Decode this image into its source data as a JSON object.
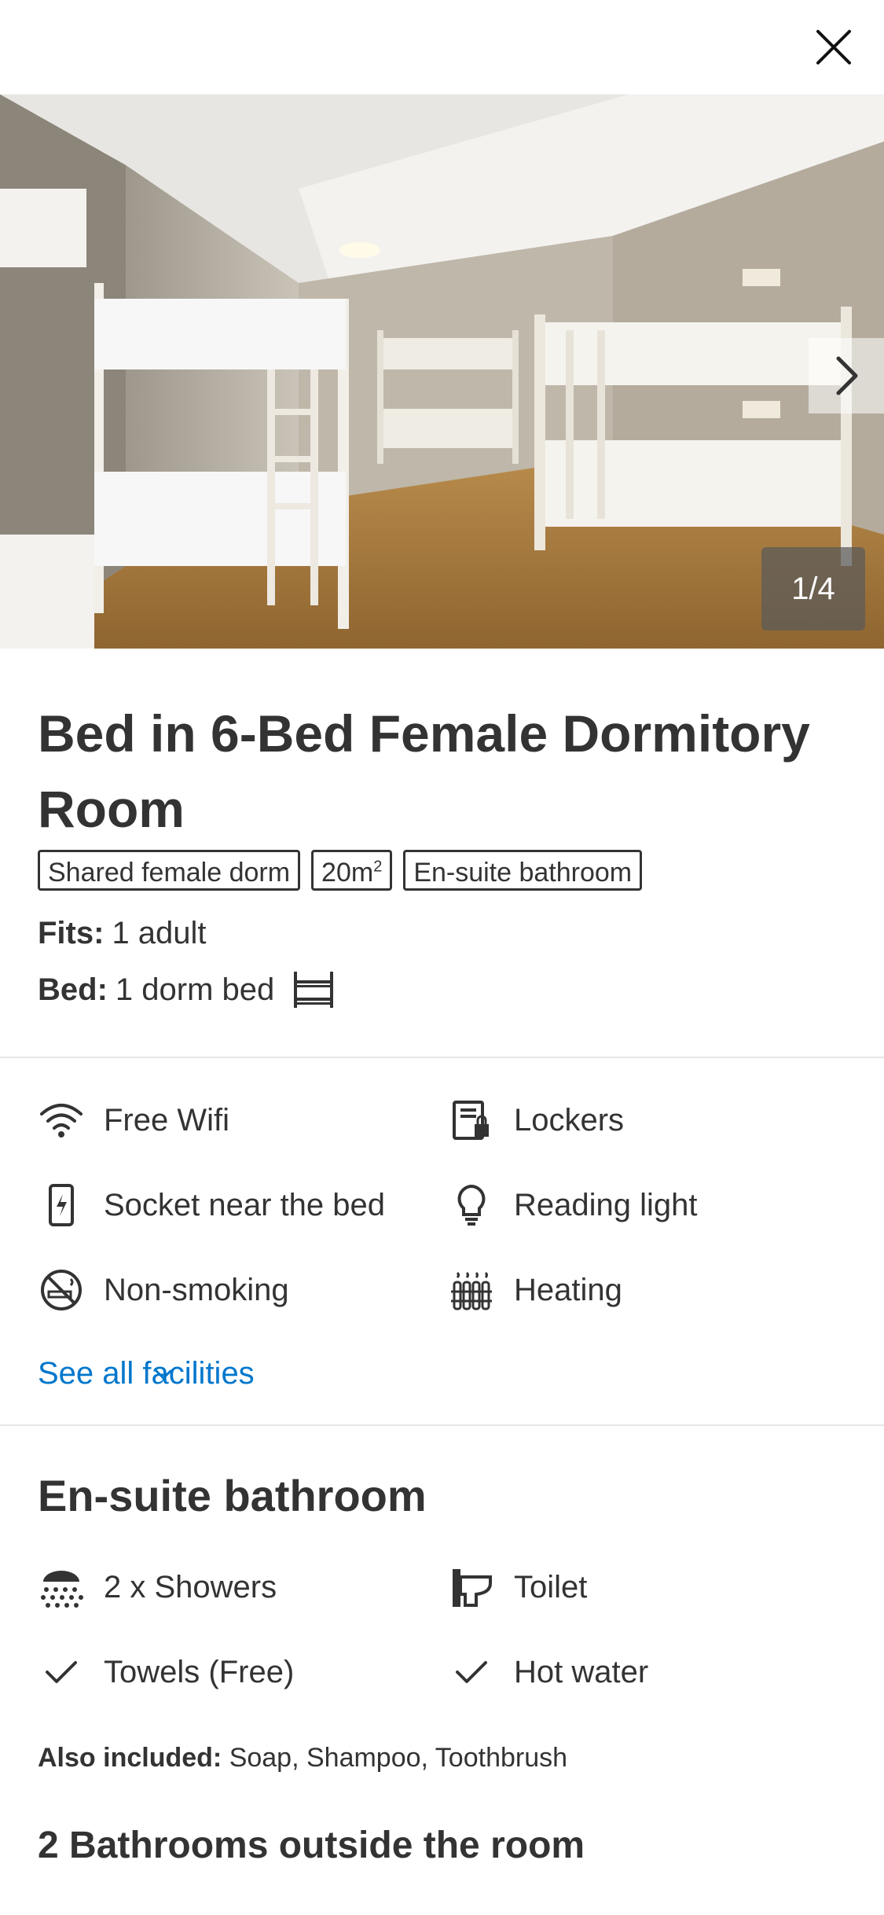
{
  "header": {
    "close_icon": "close-icon"
  },
  "gallery": {
    "counter": "1/4",
    "next_icon": "chevron-right-icon"
  },
  "room": {
    "title": "Bed in 6-Bed Female Dormitory Room",
    "tags": [
      "Shared female dorm",
      "20m",
      "En-suite bathroom"
    ],
    "tag_size_sup": "2",
    "fits_label": "Fits:",
    "fits_value": "1 adult",
    "bed_label": "Bed:",
    "bed_value": "1 dorm bed"
  },
  "facilities": {
    "items": [
      {
        "label": "Free Wifi",
        "icon": "wifi-icon"
      },
      {
        "label": "Lockers",
        "icon": "locker-icon"
      },
      {
        "label": "Socket near the bed",
        "icon": "phone-charge-icon"
      },
      {
        "label": "Reading light",
        "icon": "lightbulb-icon"
      },
      {
        "label": "Non-smoking",
        "icon": "no-smoking-icon"
      },
      {
        "label": "Heating",
        "icon": "radiator-icon"
      }
    ],
    "see_all": "See all facilities"
  },
  "bathroom": {
    "title": "En-suite bathroom",
    "items": [
      {
        "label": "2 x Showers",
        "icon": "shower-icon"
      },
      {
        "label": "Toilet",
        "icon": "toilet-icon"
      },
      {
        "label": "Towels (Free)",
        "icon": "check-icon"
      },
      {
        "label": "Hot water",
        "icon": "check-icon"
      }
    ],
    "also_label": "Also included:",
    "also_value": "Soap, Shampoo, Toothbrush",
    "outside_title": "2 Bathrooms outside the room"
  },
  "colors": {
    "link": "#0077cc",
    "text": "#333333",
    "divider": "#e6e6e6"
  }
}
